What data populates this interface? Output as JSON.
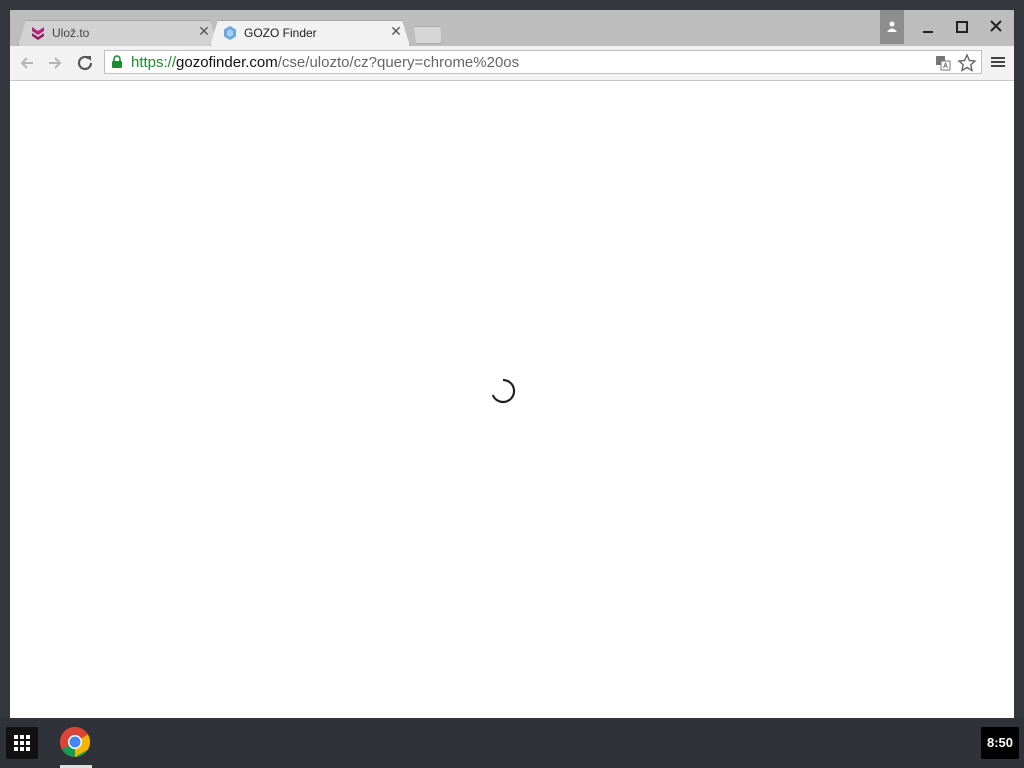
{
  "browser": {
    "tabs": [
      {
        "title": "Ulož.to",
        "favicon": "ulozto-logo-icon",
        "active": false
      },
      {
        "title": "GOZO Finder",
        "favicon": "gozo-logo-icon",
        "active": true
      }
    ],
    "close_glyph": "✕"
  },
  "omnibox": {
    "scheme": "https://",
    "host": "gozofinder.com",
    "path": "/cse/ulozto/cz?query=chrome%20os"
  },
  "shelf": {
    "clock": "8:50"
  },
  "colors": {
    "secure_green": "#1a8f2e",
    "ulozto_magenta": "#b5277e",
    "gozo_blue": "#6aa8e0"
  }
}
